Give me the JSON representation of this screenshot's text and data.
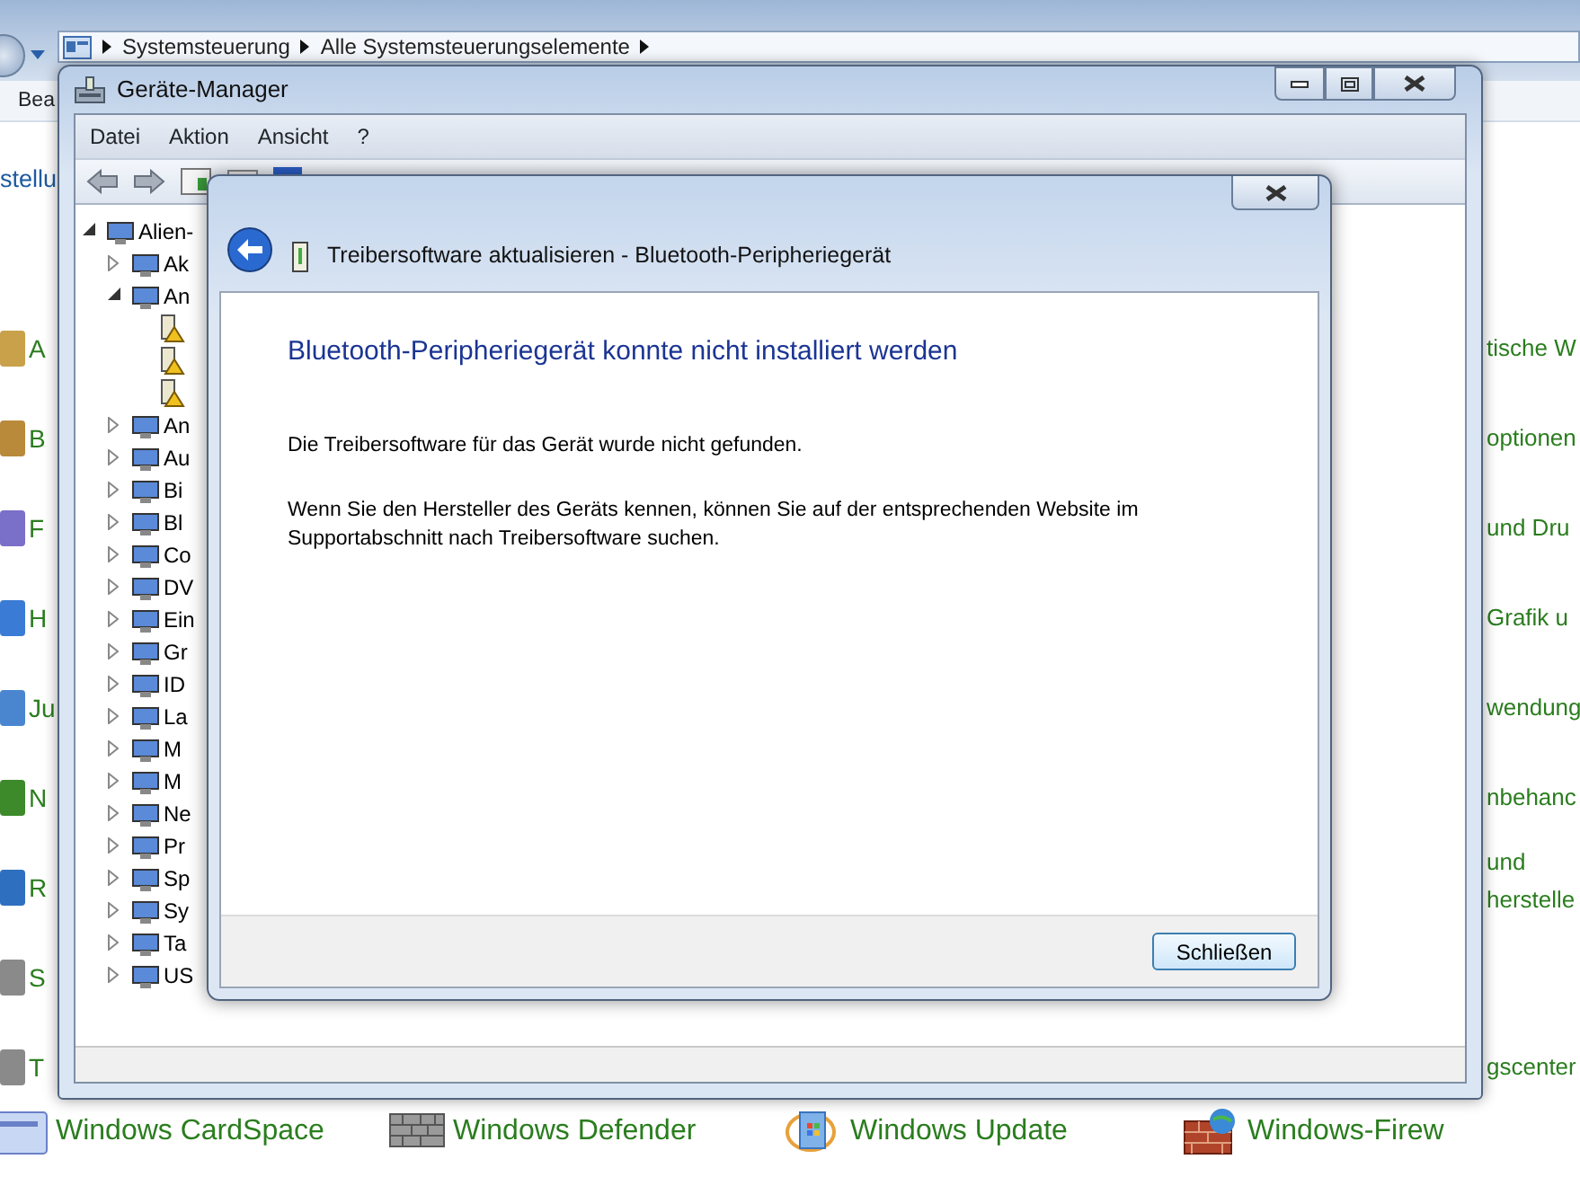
{
  "explorer": {
    "breadcrumbs": [
      "Systemsteuerung",
      "Alle Systemsteuerungselemente"
    ],
    "menu": [
      "Bea"
    ],
    "heading": "stellu",
    "left_items": [
      "A",
      "B",
      "F",
      "H",
      "Ju",
      "N",
      "R",
      "S",
      "T"
    ],
    "right_items": [
      {
        "lines": [
          "tische W"
        ]
      },
      {
        "lines": [
          "optionen"
        ]
      },
      {
        "lines": [
          "und Dru"
        ]
      },
      {
        "lines": [
          "Grafik u"
        ]
      },
      {
        "lines": [
          "wendung"
        ]
      },
      {
        "lines": [
          "nbehanc"
        ]
      },
      {
        "lines": [
          "und",
          "herstelle"
        ]
      },
      {
        "lines": [
          "gscenter"
        ]
      }
    ],
    "bottom_items": [
      {
        "label": "Windows CardSpace",
        "kind": "card"
      },
      {
        "label": "Windows Defender",
        "kind": "wall"
      },
      {
        "label": "Windows Update",
        "kind": "update"
      },
      {
        "label": "Windows-Firew",
        "kind": "firewall"
      }
    ]
  },
  "device_manager": {
    "title": "Geräte-Manager",
    "menu": [
      "Datei",
      "Aktion",
      "Ansicht",
      "?"
    ],
    "tree": [
      {
        "label": "Alien-",
        "kind": "device",
        "expanded": true,
        "children": [
          {
            "label": "Ak",
            "kind": "device",
            "expanded": false
          },
          {
            "label": "An",
            "kind": "device",
            "expanded": true,
            "children": [
              {
                "kind": "warning"
              },
              {
                "kind": "warning"
              },
              {
                "kind": "warning"
              }
            ]
          },
          {
            "label": "An",
            "kind": "device",
            "expanded": false
          },
          {
            "label": "Au",
            "kind": "device",
            "expanded": false
          },
          {
            "label": "Bi",
            "kind": "device",
            "expanded": false
          },
          {
            "label": "Bl",
            "kind": "device",
            "expanded": false
          },
          {
            "label": "Co",
            "kind": "device",
            "expanded": false
          },
          {
            "label": "DV",
            "kind": "device",
            "expanded": false
          },
          {
            "label": "Ein",
            "kind": "device",
            "expanded": false
          },
          {
            "label": "Gr",
            "kind": "device",
            "expanded": false
          },
          {
            "label": "ID",
            "kind": "device",
            "expanded": false
          },
          {
            "label": "La",
            "kind": "device",
            "expanded": false
          },
          {
            "label": "M",
            "kind": "device",
            "expanded": false
          },
          {
            "label": "M",
            "kind": "device",
            "expanded": false
          },
          {
            "label": "Ne",
            "kind": "device",
            "expanded": false
          },
          {
            "label": "Pr",
            "kind": "device",
            "expanded": false
          },
          {
            "label": "Sp",
            "kind": "device",
            "expanded": false
          },
          {
            "label": "Sy",
            "kind": "device",
            "expanded": false
          },
          {
            "label": "Ta",
            "kind": "device",
            "expanded": false
          },
          {
            "label": "US",
            "kind": "device",
            "expanded": false
          }
        ]
      }
    ]
  },
  "dialog": {
    "title": "Treibersoftware aktualisieren - Bluetooth-Peripheriegerät",
    "heading": "Bluetooth-Peripheriegerät konnte nicht installiert werden",
    "paragraphs": [
      "Die Treibersoftware für das Gerät wurde nicht gefunden.",
      "Wenn Sie den Hersteller des Geräts kennen, können Sie auf der entsprechenden Website im Supportabschnitt nach Treibersoftware suchen."
    ],
    "button": "Schließen"
  }
}
